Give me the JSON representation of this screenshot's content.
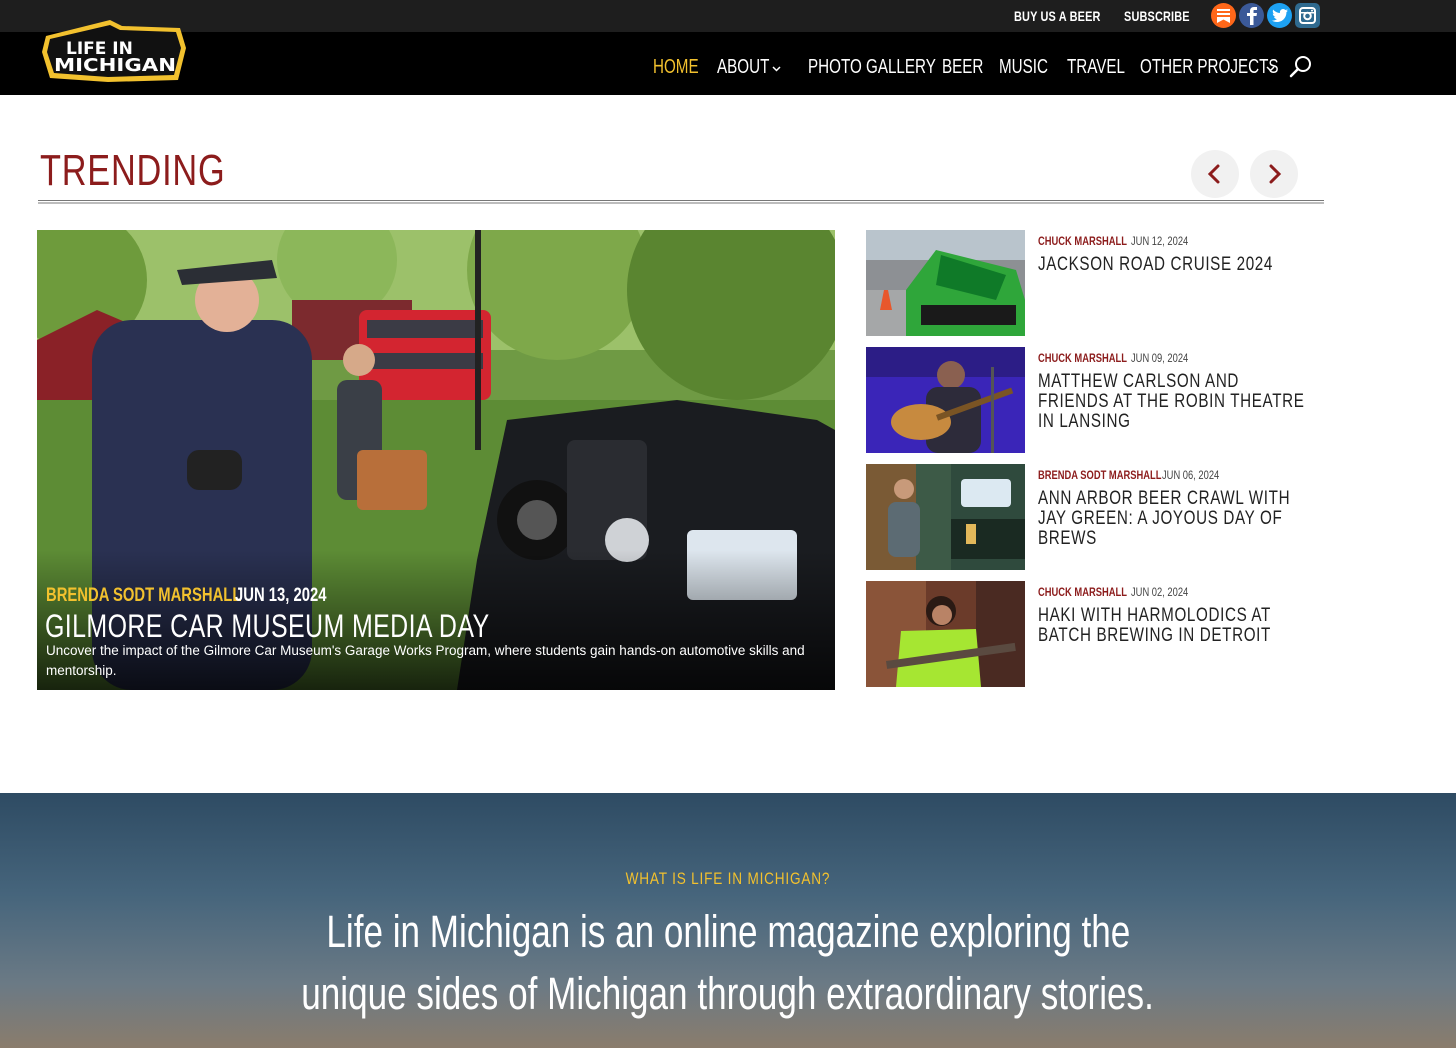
{
  "colors": {
    "accent_yellow": "#f2c12e",
    "accent_red": "#8c1c1c",
    "nav_bg": "#000000",
    "topbar_bg": "#1e1e1e"
  },
  "topbar": {
    "links": [
      "BUY US A BEER",
      "SUBSCRIBE"
    ],
    "social_icons": [
      "substack-icon",
      "facebook-icon",
      "twitter-icon",
      "instagram-icon"
    ]
  },
  "header": {
    "logo": {
      "line1": "LIFE IN",
      "line2": "MICHIGAN",
      "icon": "logo-icon"
    },
    "nav": [
      {
        "label": "HOME",
        "active": true
      },
      {
        "label": "ABOUT",
        "dropdown": true
      },
      {
        "label": "PHOTO GALLERY"
      },
      {
        "label": "BEER"
      },
      {
        "label": "MUSIC"
      },
      {
        "label": "TRAVEL"
      },
      {
        "label": "OTHER PROJECTS",
        "dropdown": true
      }
    ],
    "search_icon": "search-icon"
  },
  "trending": {
    "title": "TRENDING",
    "prev_icon": "chevron-left-icon",
    "next_icon": "chevron-right-icon",
    "featured": {
      "author": "BRENDA SODT MARSHALL",
      "date": "JUN 13, 2024",
      "title": "GILMORE CAR MUSEUM MEDIA DAY",
      "description": "Uncover the impact of the Gilmore Car Museum's Garage Works Program, where students gain hands-on automotive skills and mentorship."
    },
    "items": [
      {
        "author": "CHUCK MARSHALL",
        "date": "JUN 12, 2024",
        "title": "JACKSON ROAD CRUISE 2024"
      },
      {
        "author": "CHUCK MARSHALL",
        "date": "JUN 09, 2024",
        "title": "MATTHEW CARLSON AND FRIENDS AT THE ROBIN THEATRE IN LANSING"
      },
      {
        "author": "BRENDA SODT MARSHALL",
        "date": "JUN 06, 2024",
        "title": "ANN ARBOR BEER CRAWL WITH JAY GREEN: A JOYOUS DAY OF BREWS"
      },
      {
        "author": "CHUCK MARSHALL",
        "date": "JUN 02, 2024",
        "title": "HAKI WITH HARMOLODICS AT BATCH BREWING IN DETROIT"
      }
    ]
  },
  "about": {
    "eyebrow": "WHAT IS LIFE IN MICHIGAN?",
    "lead_line1": "Life in Michigan is an online magazine exploring the",
    "lead_line2": "unique sides of Michigan through extraordinary stories."
  }
}
